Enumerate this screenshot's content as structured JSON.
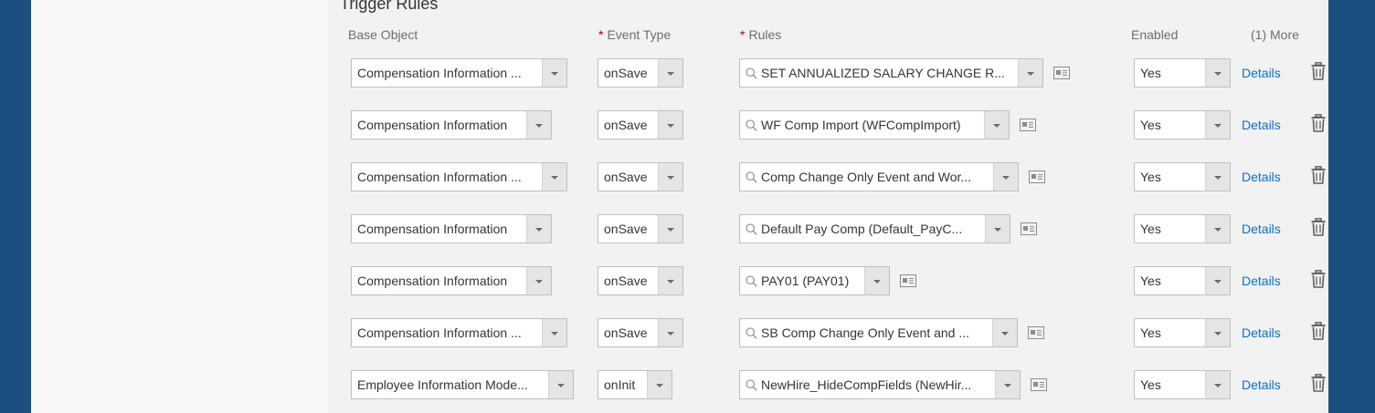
{
  "section": {
    "title": "Trigger Rules"
  },
  "columns": {
    "base_object": "Base Object",
    "event_type": "Event Type",
    "event_type_required": "*",
    "rules": "Rules",
    "rules_required": "*",
    "enabled": "Enabled",
    "more": "(1) More"
  },
  "rows": [
    {
      "base_object": "Compensation Information ...",
      "event_type": "onSave",
      "rule": "SET ANNUALIZED SALARY CHANGE R...",
      "enabled": "Yes",
      "details": "Details"
    },
    {
      "base_object": "Compensation Information",
      "event_type": "onSave",
      "rule": "WF Comp Import (WFCompImport)",
      "enabled": "Yes",
      "details": "Details"
    },
    {
      "base_object": "Compensation Information ...",
      "event_type": "onSave",
      "rule": "Comp Change Only Event and Wor...",
      "enabled": "Yes",
      "details": "Details"
    },
    {
      "base_object": "Compensation Information",
      "event_type": "onSave",
      "rule": "Default Pay Comp (Default_PayC...",
      "enabled": "Yes",
      "details": "Details"
    },
    {
      "base_object": "Compensation Information",
      "event_type": "onSave",
      "rule": "PAY01 (PAY01)",
      "enabled": "Yes",
      "details": "Details"
    },
    {
      "base_object": "Compensation Information ...",
      "event_type": "onSave",
      "rule": "SB Comp Change Only Event and ...",
      "enabled": "Yes",
      "details": "Details"
    },
    {
      "base_object": "Employee Information Mode...",
      "event_type": "onInit",
      "rule": "NewHire_HideCompFields (NewHir...",
      "enabled": "Yes",
      "details": "Details"
    }
  ]
}
